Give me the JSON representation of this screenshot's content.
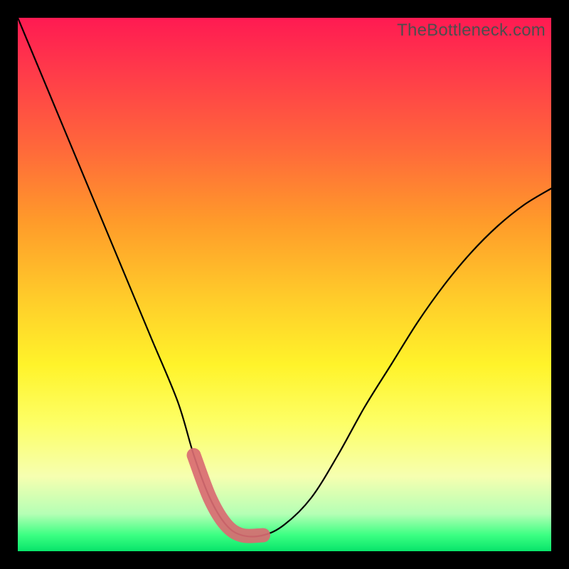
{
  "watermark": "TheBottleneck.com",
  "chart_data": {
    "type": "line",
    "title": "",
    "xlabel": "",
    "ylabel": "",
    "xlim": [
      0,
      100
    ],
    "ylim": [
      0,
      100
    ],
    "series": [
      {
        "name": "bottleneck-curve",
        "x": [
          0,
          5,
          10,
          15,
          20,
          25,
          30,
          33,
          36,
          39,
          42,
          46,
          50,
          55,
          60,
          65,
          70,
          75,
          80,
          85,
          90,
          95,
          100
        ],
        "values": [
          100,
          88,
          76,
          64,
          52,
          40,
          28,
          18,
          10,
          5,
          3,
          3,
          5,
          10,
          18,
          27,
          35,
          43,
          50,
          56,
          61,
          65,
          68
        ]
      }
    ],
    "highlight": {
      "name": "optimal-zone",
      "x": [
        33,
        36,
        39,
        42,
        46
      ],
      "values": [
        18,
        10,
        5,
        3,
        3
      ]
    }
  }
}
